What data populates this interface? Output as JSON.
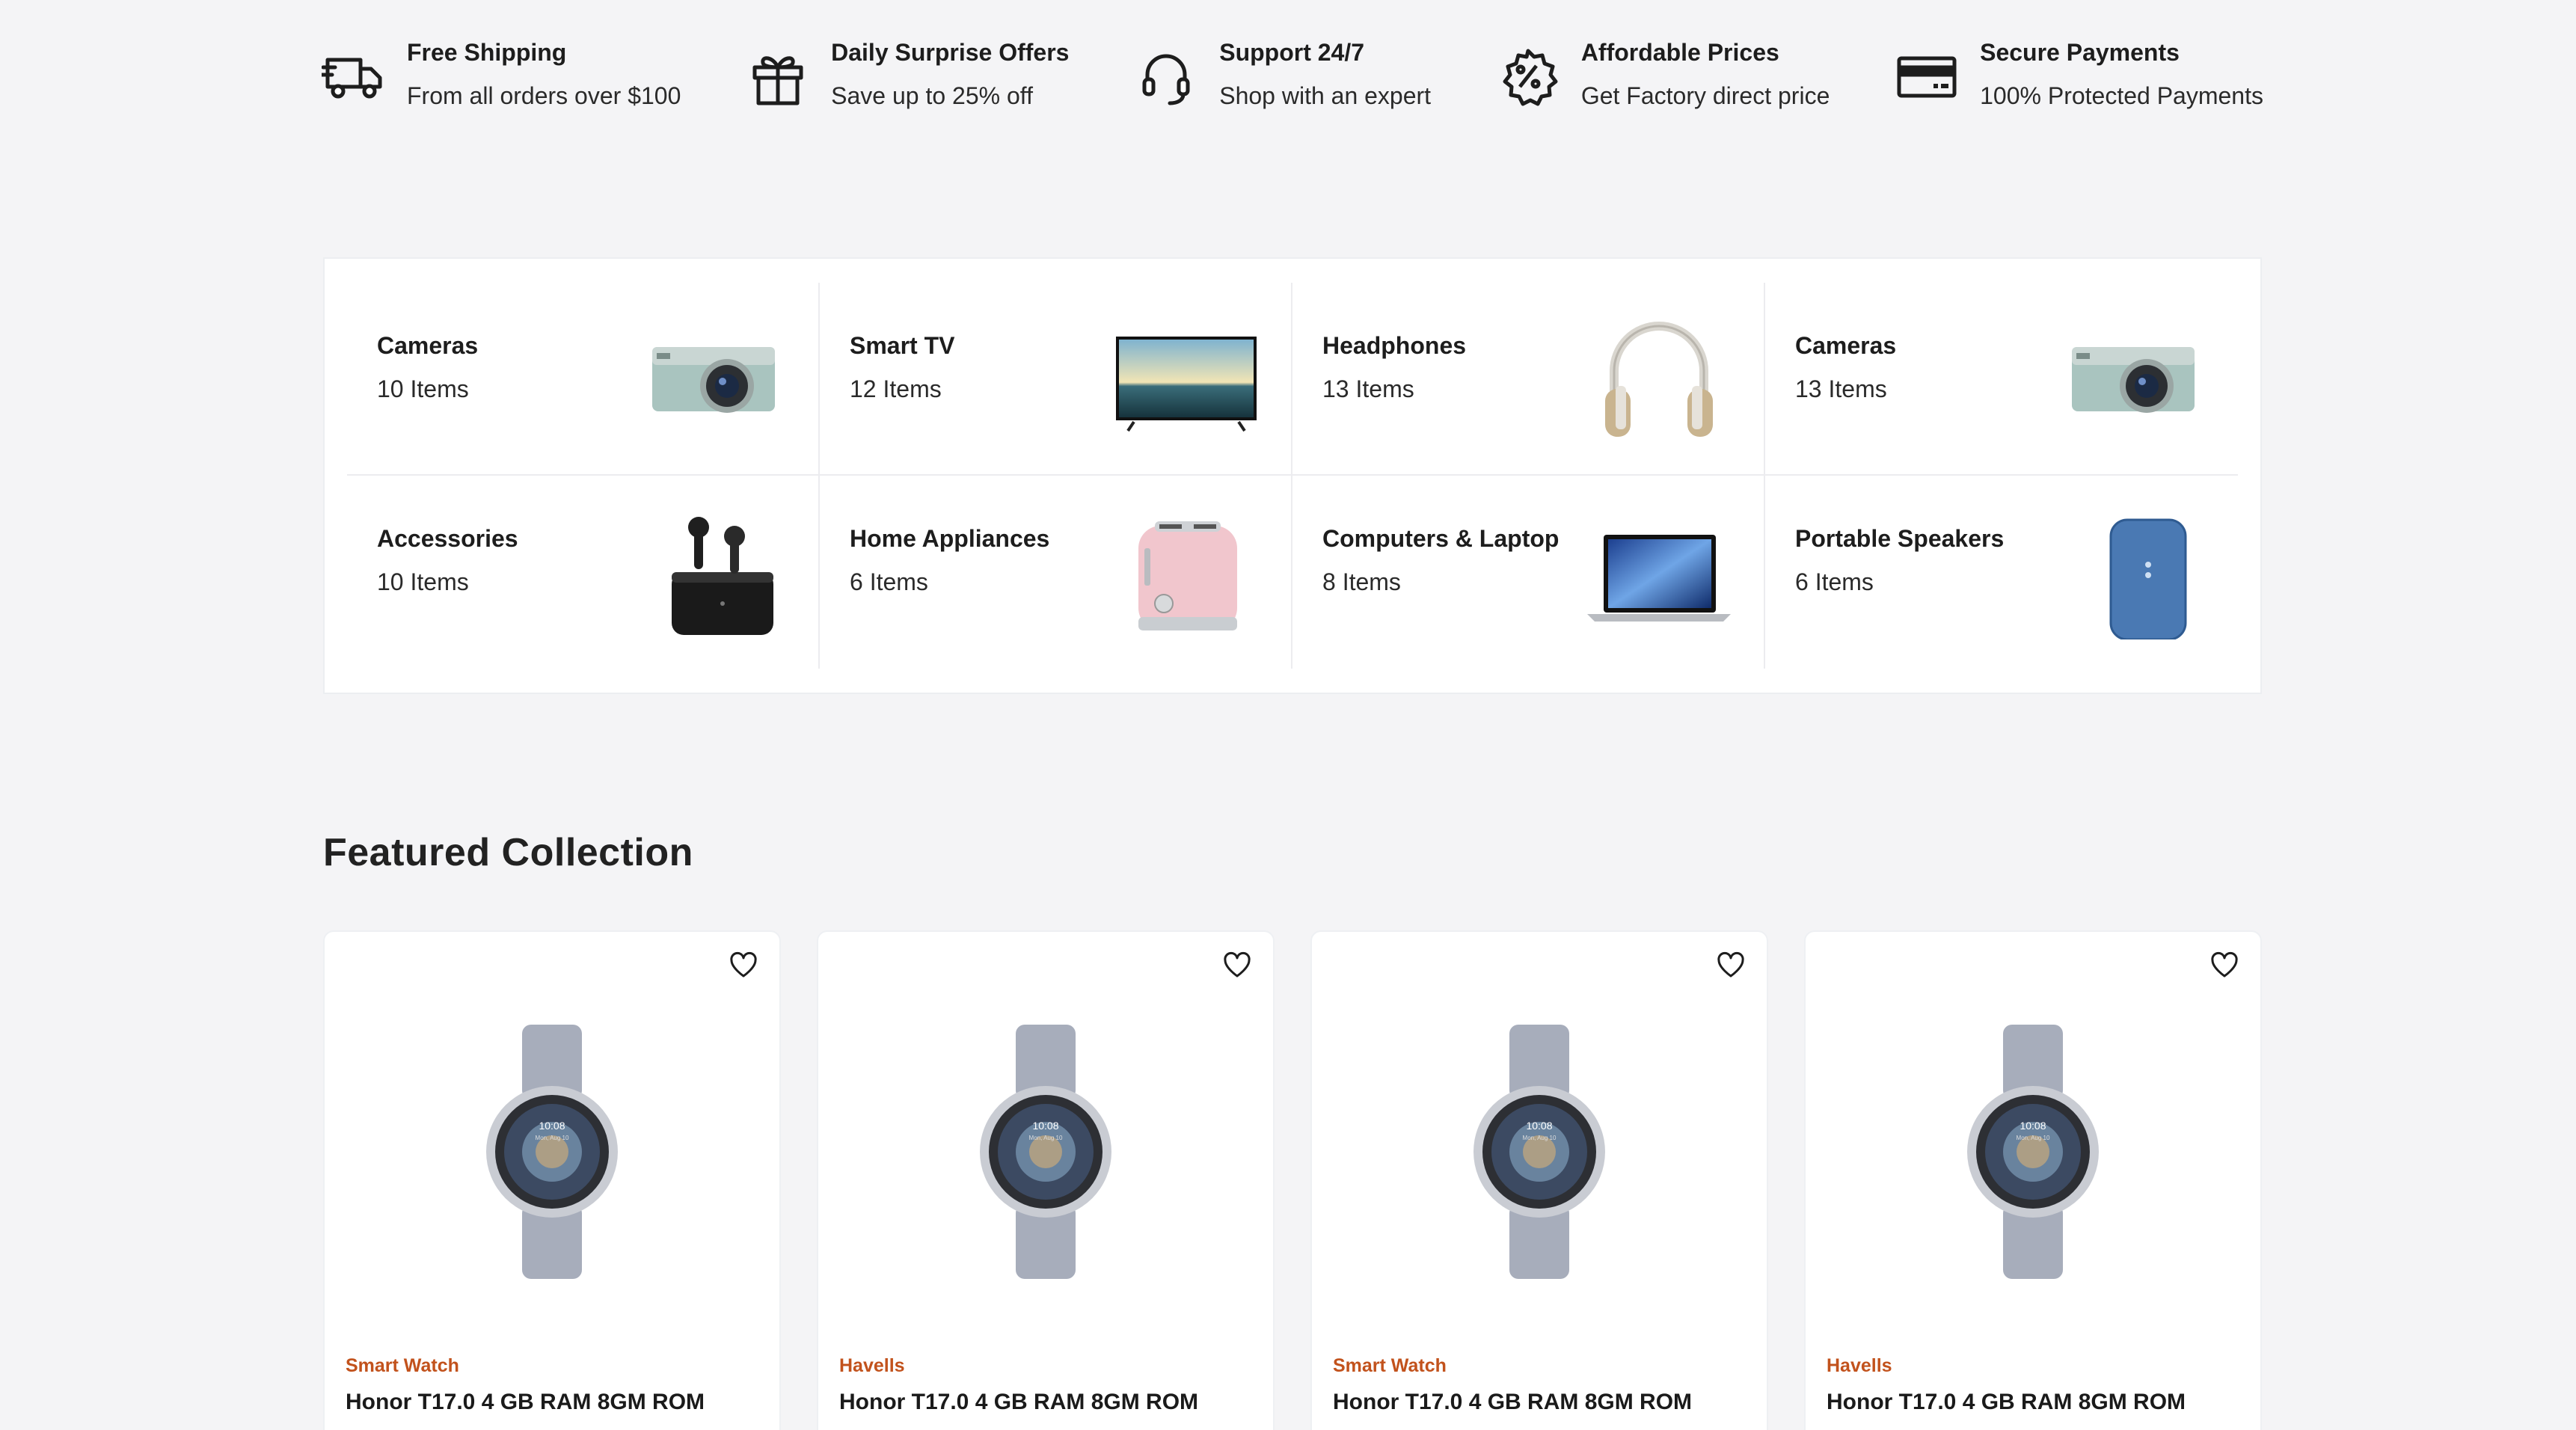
{
  "services": [
    {
      "icon": "truck-icon",
      "title": "Free Shipping",
      "subtitle": "From all orders over $100"
    },
    {
      "icon": "gift-icon",
      "title": "Daily Surprise Offers",
      "subtitle": "Save up to 25% off"
    },
    {
      "icon": "headset-icon",
      "title": "Support 24/7",
      "subtitle": "Shop with an expert"
    },
    {
      "icon": "discount-badge-icon",
      "title": "Affordable Prices",
      "subtitle": "Get Factory direct price"
    },
    {
      "icon": "credit-card-icon",
      "title": "Secure Payments",
      "subtitle": "100% Protected Payments"
    }
  ],
  "categories": [
    {
      "name": "Cameras",
      "count": "10 Items",
      "image": "camera-image"
    },
    {
      "name": "Smart TV",
      "count": "12 Items",
      "image": "tv-image"
    },
    {
      "name": "Headphones",
      "count": "13 Items",
      "image": "headphones-image"
    },
    {
      "name": "Cameras",
      "count": "13 Items",
      "image": "camera-image"
    },
    {
      "name": "Accessories",
      "count": "10 Items",
      "image": "earbuds-image"
    },
    {
      "name": "Home Appliances",
      "count": "6 Items",
      "image": "toaster-image"
    },
    {
      "name": "Computers & Laptop",
      "count": "8 Items",
      "image": "laptop-image"
    },
    {
      "name": "Portable Speakers",
      "count": "6 Items",
      "image": "speaker-image"
    }
  ],
  "featured": {
    "title": "Featured Collection",
    "products": [
      {
        "brand": "Smart Watch",
        "name": "Honor T17.0 4 GB RAM 8GM ROM",
        "image": "smartwatch-image"
      },
      {
        "brand": "Havells",
        "name": "Honor T17.0 4 GB RAM 8GM ROM",
        "image": "smartwatch-image"
      },
      {
        "brand": "Smart Watch",
        "name": "Honor T17.0 4 GB RAM 8GM ROM",
        "image": "smartwatch-image"
      },
      {
        "brand": "Havells",
        "name": "Honor T17.0 4 GB RAM 8GM ROM",
        "image": "smartwatch-image"
      }
    ]
  },
  "colors": {
    "background": "#f4f4f6",
    "brand_accent": "#c2521c",
    "text": "#1d1d1d"
  },
  "watch_face": {
    "time": "10:08",
    "date": "Mon, Aug 10"
  }
}
